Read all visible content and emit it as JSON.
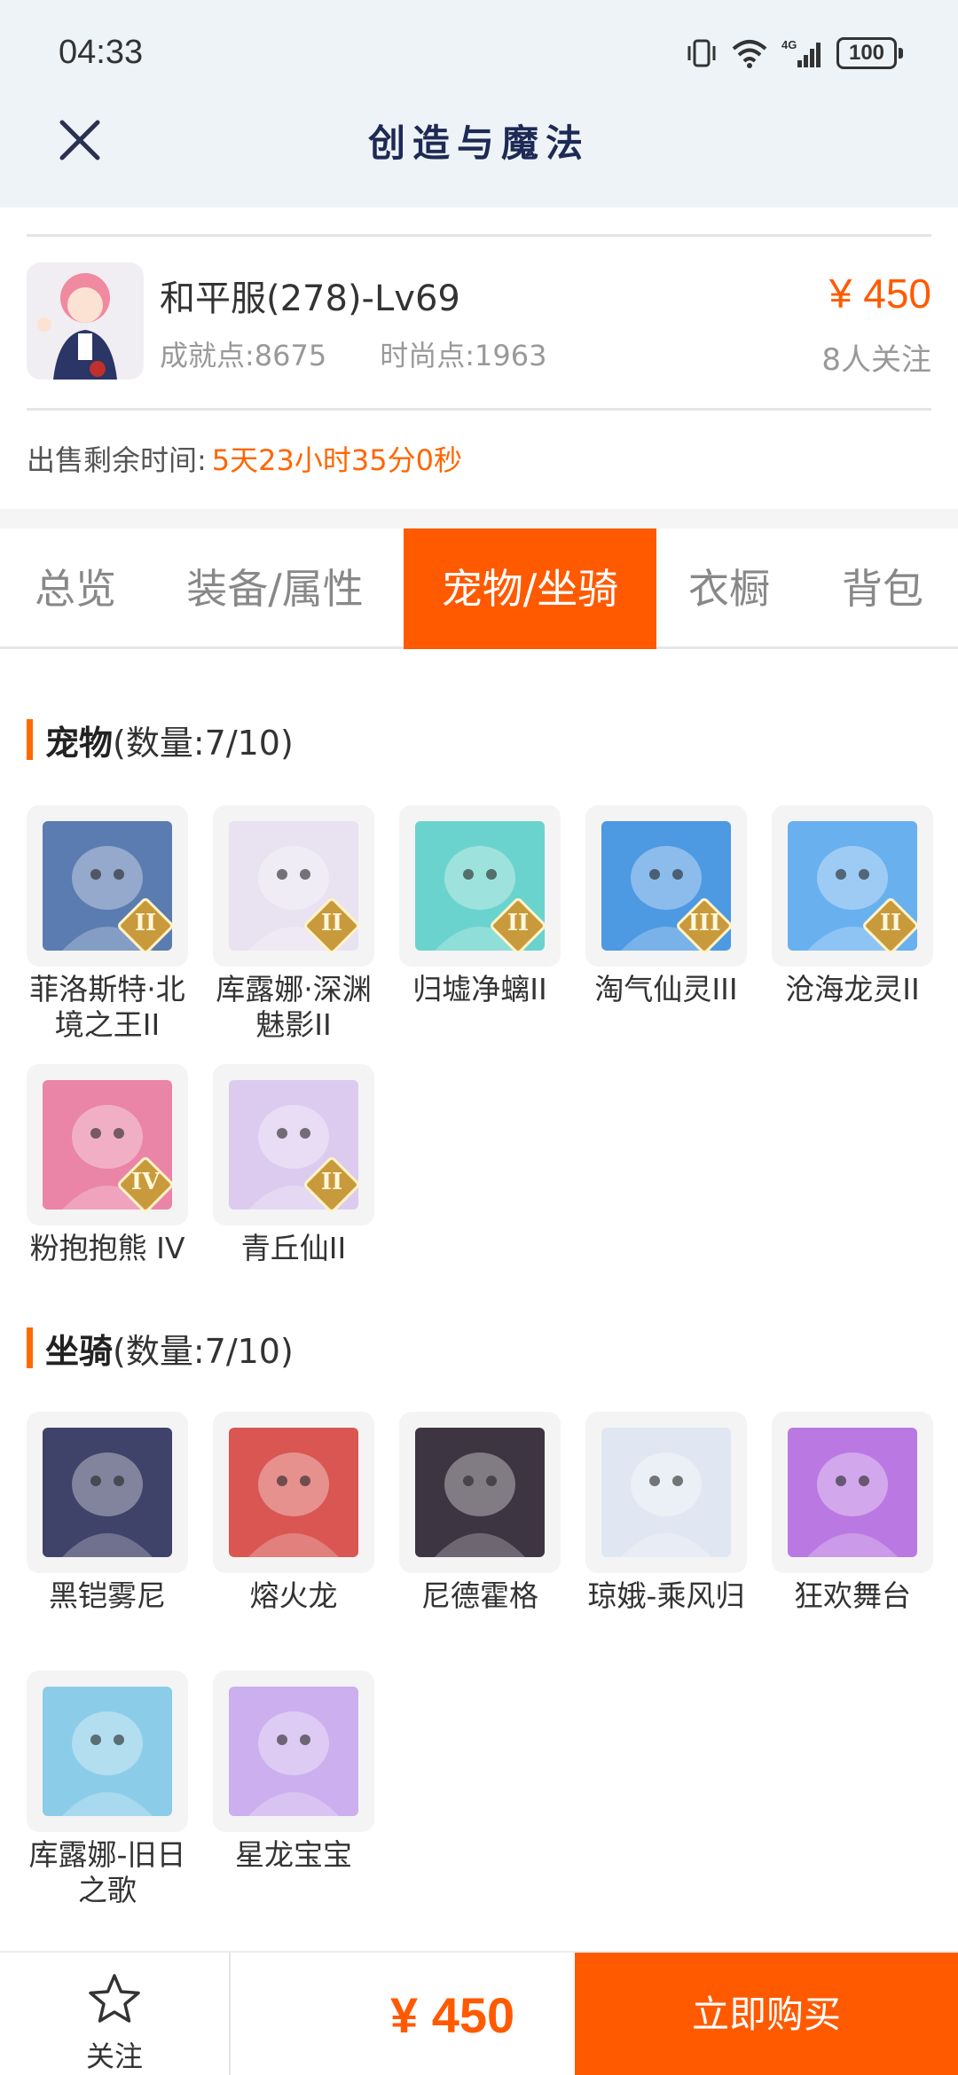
{
  "status_bar": {
    "time": "04:33",
    "battery": "100",
    "network": "4G"
  },
  "header": {
    "title": "创造与魔法",
    "close_icon": "close-icon"
  },
  "account": {
    "name": "和平服(278)-Lv69",
    "achievement": "成就点:8675",
    "fashion": "时尚点:1963",
    "price": "¥ 450",
    "followers": "8人关注",
    "sale_time_label": "出售剩余时间:",
    "sale_time_value": "5天23小时35分0秒"
  },
  "tabs": [
    {
      "label": "总览",
      "active": false
    },
    {
      "label": "装备/属性",
      "active": false
    },
    {
      "label": "宠物/坐骑",
      "active": true
    },
    {
      "label": "衣橱",
      "active": false
    },
    {
      "label": "背包",
      "active": false
    }
  ],
  "pets": {
    "title": "宠物",
    "count": "(数量:7/10)",
    "items": [
      {
        "name": "菲洛斯特·北境之王II",
        "badge": "II",
        "color": "#4a6fa8"
      },
      {
        "name": "库露娜·深渊魅影II",
        "badge": "II",
        "color": "#e8e0f0"
      },
      {
        "name": "归墟净螭II",
        "badge": "II",
        "color": "#5ccfc9"
      },
      {
        "name": "淘气仙灵III",
        "badge": "III",
        "color": "#3b8fe0"
      },
      {
        "name": "沧海龙灵II",
        "badge": "II",
        "color": "#5aa9ee"
      },
      {
        "name": "粉抱抱熊 IV",
        "badge": "IV",
        "color": "#e9799e"
      },
      {
        "name": "青丘仙II",
        "badge": "II",
        "color": "#d9c6ee"
      }
    ]
  },
  "mounts": {
    "title": "坐骑",
    "count": "(数量:7/10)",
    "items": [
      {
        "name": "黑铠雾尼",
        "color": "#2b2f5a"
      },
      {
        "name": "熔火龙",
        "color": "#d64540"
      },
      {
        "name": "尼德霍格",
        "color": "#2a2030"
      },
      {
        "name": "琼娥-乘风归",
        "color": "#dfe6f2"
      },
      {
        "name": "狂欢舞台",
        "color": "#b46ce0"
      },
      {
        "name": "库露娜-旧日之歌",
        "color": "#7fc9e8"
      },
      {
        "name": "星龙宝宝",
        "color": "#c8a7ee"
      }
    ]
  },
  "bottom_bar": {
    "follow_label": "关注",
    "price": "¥ 450",
    "buy_label": "立即购买"
  },
  "colors": {
    "accent": "#ff5a00",
    "title": "#1e2a55"
  }
}
